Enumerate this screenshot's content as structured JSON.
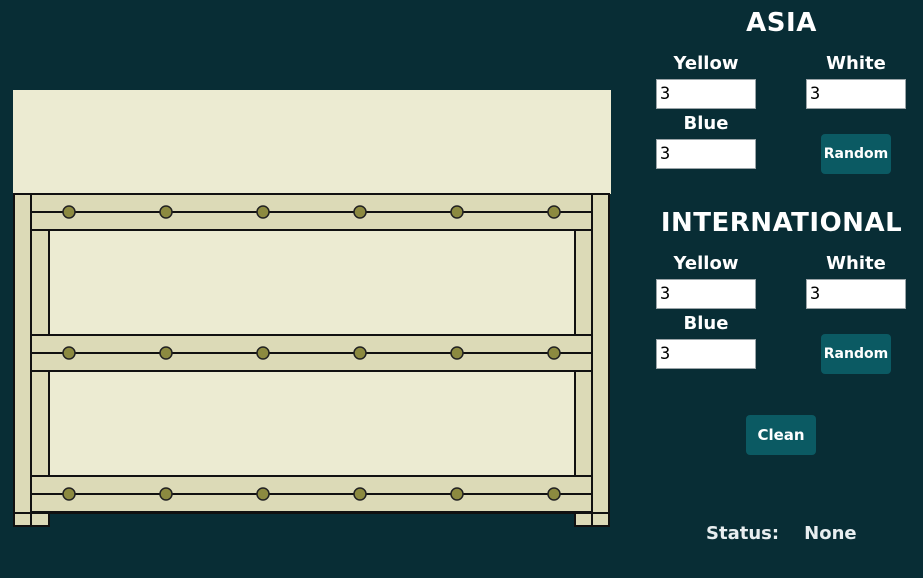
{
  "asia": {
    "title": "ASIA",
    "yellow_label": "Yellow",
    "white_label": "White",
    "blue_label": "Blue",
    "yellow_value": "3",
    "white_value": "3",
    "blue_value": "3",
    "random_label": "Random"
  },
  "international": {
    "title": "INTERNATIONAL",
    "yellow_label": "Yellow",
    "white_label": "White",
    "blue_label": "Blue",
    "yellow_value": "3",
    "white_value": "3",
    "blue_value": "3",
    "random_label": "Random"
  },
  "clean_label": "Clean",
  "status": {
    "label": "Status:",
    "value": "None"
  },
  "colors": {
    "background": "#082d35",
    "button": "#0b5a63",
    "rack_fill": "#ecebd2",
    "rack_frame": "#dcdab7",
    "peg": "#8c8a40"
  }
}
